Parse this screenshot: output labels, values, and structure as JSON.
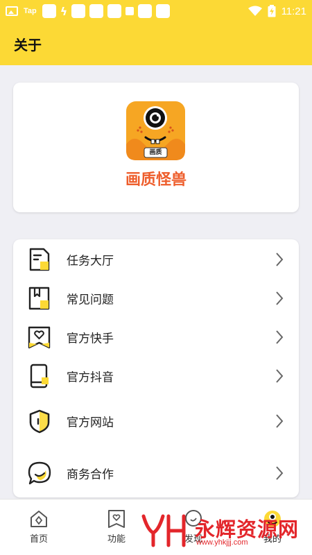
{
  "status_bar": {
    "carrier_text": "Tap",
    "time": "11:21"
  },
  "app_bar": {
    "title": "关于"
  },
  "about": {
    "logo_badge": "画质",
    "app_name": "画质怪兽"
  },
  "menu": {
    "items": [
      {
        "label": "任务大厅",
        "icon": "task-hall-icon"
      },
      {
        "label": "常见问题",
        "icon": "faq-book-icon"
      },
      {
        "label": "官方快手",
        "icon": "kuaishou-heart-icon"
      },
      {
        "label": "官方抖音",
        "icon": "douyin-phone-icon"
      },
      {
        "label": "官方网站",
        "icon": "website-shield-icon"
      },
      {
        "label": "商务合作",
        "icon": "business-chat-icon"
      }
    ]
  },
  "bottom_nav": {
    "items": [
      {
        "label": "首页",
        "icon": "home-icon"
      },
      {
        "label": "功能",
        "icon": "feature-icon"
      },
      {
        "label": "发现",
        "icon": "discover-icon"
      },
      {
        "label": "我的",
        "icon": "mine-monster-icon"
      }
    ]
  },
  "watermark": {
    "text": "永辉资源网",
    "url": "www.yhkjjj.com"
  },
  "colors": {
    "brand_yellow": "#fcd935",
    "app_name_orange": "#ee5e2c",
    "watermark_red": "#e3262b"
  }
}
